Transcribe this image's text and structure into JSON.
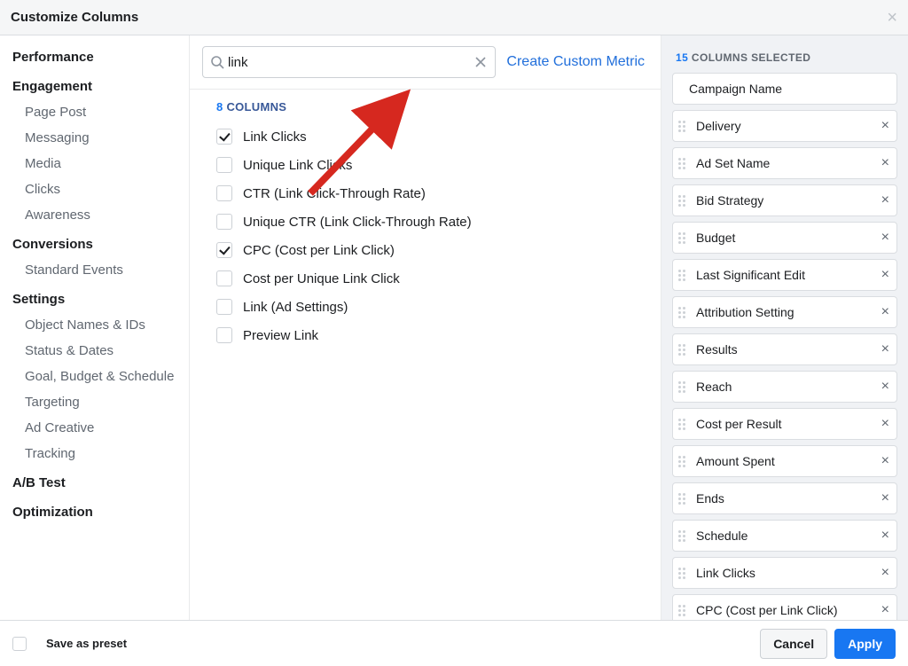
{
  "title": "Customize Columns",
  "search": {
    "value": "link",
    "create_label": "Create Custom Metric"
  },
  "columns_header": {
    "count": "8",
    "suffix": " COLUMNS"
  },
  "sidebar": [
    {
      "label": "Performance",
      "type": "cat"
    },
    {
      "label": "Engagement",
      "type": "cat"
    },
    {
      "label": "Page Post",
      "type": "sub"
    },
    {
      "label": "Messaging",
      "type": "sub"
    },
    {
      "label": "Media",
      "type": "sub"
    },
    {
      "label": "Clicks",
      "type": "sub"
    },
    {
      "label": "Awareness",
      "type": "sub"
    },
    {
      "label": "Conversions",
      "type": "cat"
    },
    {
      "label": "Standard Events",
      "type": "sub"
    },
    {
      "label": "Settings",
      "type": "cat"
    },
    {
      "label": "Object Names & IDs",
      "type": "sub"
    },
    {
      "label": "Status & Dates",
      "type": "sub"
    },
    {
      "label": "Goal, Budget & Schedule",
      "type": "sub"
    },
    {
      "label": "Targeting",
      "type": "sub"
    },
    {
      "label": "Ad Creative",
      "type": "sub"
    },
    {
      "label": "Tracking",
      "type": "sub"
    },
    {
      "label": "A/B Test",
      "type": "cat"
    },
    {
      "label": "Optimization",
      "type": "cat"
    }
  ],
  "options": [
    {
      "label": "Link Clicks",
      "checked": true
    },
    {
      "label": "Unique Link Clicks",
      "checked": false
    },
    {
      "label": "CTR (Link Click-Through Rate)",
      "checked": false
    },
    {
      "label": "Unique CTR (Link Click-Through Rate)",
      "checked": false
    },
    {
      "label": "CPC (Cost per Link Click)",
      "checked": true
    },
    {
      "label": "Cost per Unique Link Click",
      "checked": false
    },
    {
      "label": "Link (Ad Settings)",
      "checked": false
    },
    {
      "label": "Preview Link",
      "checked": false
    }
  ],
  "selected": {
    "count": "15",
    "suffix": " COLUMNS SELECTED",
    "items": [
      {
        "label": "Campaign Name",
        "fixed": true
      },
      {
        "label": "Delivery"
      },
      {
        "label": "Ad Set Name"
      },
      {
        "label": "Bid Strategy"
      },
      {
        "label": "Budget"
      },
      {
        "label": "Last Significant Edit"
      },
      {
        "label": "Attribution Setting"
      },
      {
        "label": "Results"
      },
      {
        "label": "Reach"
      },
      {
        "label": "Cost per Result"
      },
      {
        "label": "Amount Spent"
      },
      {
        "label": "Ends"
      },
      {
        "label": "Schedule"
      },
      {
        "label": "Link Clicks"
      },
      {
        "label": "CPC (Cost per Link Click)"
      }
    ]
  },
  "footer": {
    "preset": "Save as preset",
    "cancel": "Cancel",
    "apply": "Apply"
  }
}
